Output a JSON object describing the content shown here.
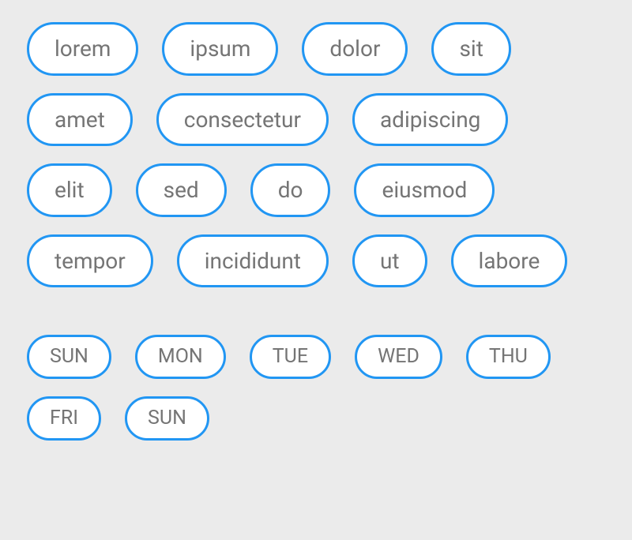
{
  "groups": {
    "words": [
      "lorem",
      "ipsum",
      "dolor",
      "sit",
      "amet",
      "consectetur",
      "adipiscing",
      "elit",
      "sed",
      "do",
      "eiusmod",
      "tempor",
      "incididunt",
      "ut",
      "labore"
    ],
    "days": [
      "SUN",
      "MON",
      "TUE",
      "WED",
      "THU",
      "FRI",
      "SUN"
    ]
  }
}
